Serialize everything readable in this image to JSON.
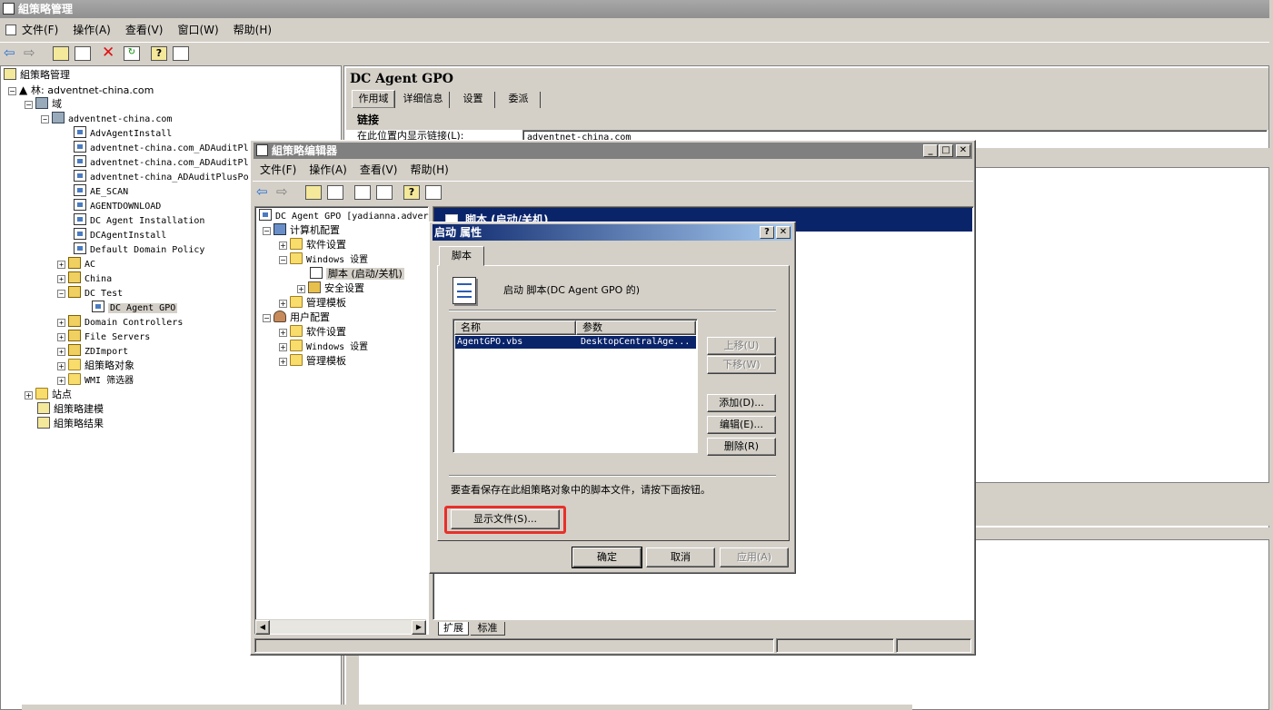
{
  "main": {
    "title": "組策略管理",
    "menu": [
      "文件(F)",
      "操作(A)",
      "查看(V)",
      "窗口(W)",
      "帮助(H)"
    ],
    "tree": {
      "root": "組策略管理",
      "forest": "林: adventnet-china.com",
      "domains": "域",
      "domain": "adventnet-china.com",
      "gpos": [
        "AdvAgentInstall",
        "adventnet-china.com_ADAuditPl",
        "adventnet-china.com_ADAuditPl",
        "adventnet-china_ADAuditPlusPo",
        "AE_SCAN",
        "AGENTDOWNLOAD",
        "DC Agent Installation",
        "DCAgentInstall",
        "Default Domain Policy"
      ],
      "ous": [
        "AC",
        "China",
        "DC Test"
      ],
      "selected": "DC Agent GPO",
      "ous2": [
        "Domain Controllers",
        "File Servers",
        "ZDImport",
        "組策略对象",
        "WMI 筛选器"
      ],
      "sites": "站点",
      "modeling": "組策略建模",
      "results": "組策略结果"
    },
    "right": {
      "title": "DC Agent GPO",
      "tabs": [
        "作用域",
        "详细信息",
        "设置",
        "委派"
      ],
      "links_heading": "链接",
      "links_label": "在此位置内显示链接(L):",
      "links_value": "adventnet-china.com"
    }
  },
  "editor": {
    "title": "組策略编辑器",
    "menu": [
      "文件(F)",
      "操作(A)",
      "查看(V)",
      "帮助(H)"
    ],
    "tree": {
      "root": "DC Agent GPO [yadianna.adver",
      "computer": "计算机配置",
      "software": "软件设置",
      "windows": "Windows 设置",
      "scripts": "脚本 (启动/关机)",
      "security": "安全设置",
      "admin": "管理模板",
      "user": "用户配置",
      "u_software": "软件设置",
      "u_windows": "Windows 设置",
      "u_admin": "管理模板"
    },
    "header": "脚本 (启动/关机)",
    "tabs": [
      "扩展",
      "标准"
    ]
  },
  "dialog": {
    "title": "启动 属性",
    "tab": "脚本",
    "description": "启动 脚本(DC Agent GPO 的)",
    "columns": [
      "名称",
      "参数"
    ],
    "rows": [
      {
        "name": "AgentGPO.vbs",
        "params": "DesktopCentralAge..."
      }
    ],
    "buttons": {
      "up": "上移(U)",
      "down": "下移(W)",
      "add": "添加(D)...",
      "edit": "编辑(E)...",
      "delete": "删除(R)"
    },
    "hint": "要查看保存在此組策略对象中的脚本文件，请按下面按钮。",
    "show_files": "显示文件(S)...",
    "ok": "确定",
    "cancel": "取消",
    "apply": "应用(A)",
    "highlight_color": "#e8302a"
  }
}
